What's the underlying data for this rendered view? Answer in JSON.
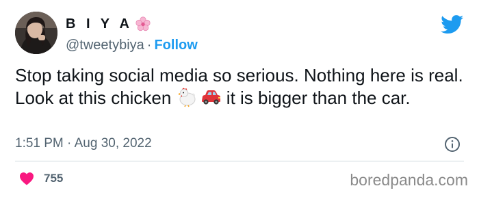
{
  "tweet": {
    "author": {
      "display_name": "B I Y A",
      "name_emoji_icon": "cherry-blossom-icon",
      "handle": "@tweetybiya",
      "separator": "·",
      "follow_label": "Follow"
    },
    "text_parts": {
      "before_emoji": "Stop taking social media so serious. Nothing here is real. Look at this chicken ",
      "emoji_1": "chicken-emoji-icon",
      "emoji_2": "car-emoji-icon",
      "after_emoji": " it is bigger than the car."
    },
    "timestamp": {
      "time": "1:51 PM",
      "separator": "·",
      "date": "Aug 30, 2022"
    },
    "likes": {
      "count": "755",
      "icon": "heart-icon"
    }
  },
  "brand": {
    "platform_icon": "twitter-bird-icon",
    "accent_color": "#1d9bf0",
    "like_color": "#f91880"
  },
  "watermark": "boredpanda.com"
}
